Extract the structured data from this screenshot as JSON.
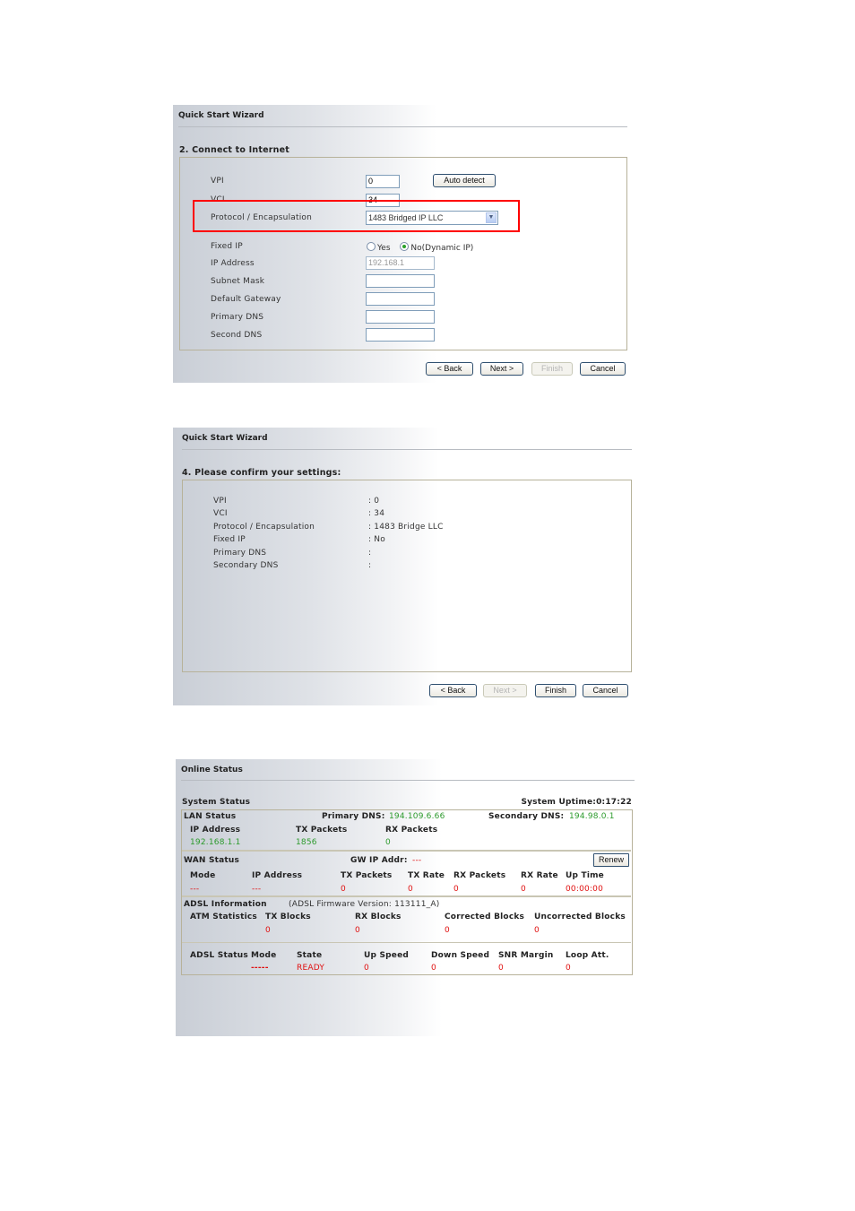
{
  "panel1": {
    "title": "Quick Start Wizard",
    "section_title": "2. Connect to Internet",
    "fields": {
      "vpi": {
        "label": "VPI",
        "value": "0"
      },
      "vci": {
        "label": "VCI",
        "value": "34"
      },
      "protocol": {
        "label": "Protocol / Encapsulation",
        "selected": "1483 Bridged IP LLC"
      },
      "fixed_ip": {
        "label": "Fixed IP",
        "options": [
          "Yes",
          "No(Dynamic IP)"
        ],
        "selected": "No(Dynamic IP)"
      },
      "ip_address": {
        "label": "IP Address",
        "value": "192.168.1"
      },
      "subnet_mask": {
        "label": "Subnet Mask",
        "value": ""
      },
      "default_gateway": {
        "label": "Default Gateway",
        "value": ""
      },
      "primary_dns": {
        "label": "Primary DNS",
        "value": ""
      },
      "second_dns": {
        "label": "Second DNS",
        "value": ""
      }
    },
    "auto_detect_label": "Auto detect",
    "buttons": {
      "back": "< Back",
      "next": "Next >",
      "finish": "Finish",
      "cancel": "Cancel"
    },
    "highlight_color": "#ff0000"
  },
  "panel2": {
    "title": "Quick Start Wizard",
    "section_title": "4. Please confirm your settings:",
    "rows": [
      {
        "label": "VPI",
        "value": ": 0"
      },
      {
        "label": "VCI",
        "value": ": 34"
      },
      {
        "label": "Protocol / Encapsulation",
        "value": ": 1483 Bridge LLC"
      },
      {
        "label": "Fixed IP",
        "value": ": No"
      },
      {
        "label": "Primary DNS",
        "value": ":"
      },
      {
        "label": "Secondary DNS",
        "value": ":"
      }
    ],
    "buttons": {
      "back": "< Back",
      "next": "Next >",
      "finish": "Finish",
      "cancel": "Cancel"
    }
  },
  "panel3": {
    "title": "Online Status",
    "system_status_label": "System Status",
    "system_uptime": "System Uptime:0:17:22",
    "lan": {
      "title": "LAN Status",
      "primary_dns_label": "Primary DNS:",
      "primary_dns": "194.109.6.66",
      "secondary_dns_label": "Secondary DNS:",
      "secondary_dns": "194.98.0.1",
      "headers": [
        "IP Address",
        "TX Packets",
        "RX Packets"
      ],
      "values": [
        "192.168.1.1",
        "1856",
        "0"
      ]
    },
    "wan": {
      "title": "WAN Status",
      "gw_label": "GW IP Addr:",
      "gw_value": "---",
      "renew_label": "Renew",
      "headers": [
        "Mode",
        "IP Address",
        "TX Packets",
        "TX Rate",
        "RX Packets",
        "RX Rate",
        "Up Time"
      ],
      "values": [
        "---",
        "---",
        "0",
        "0",
        "0",
        "0",
        "00:00:00"
      ]
    },
    "adsl": {
      "title": "ADSL Information",
      "firmware": "(ADSL Firmware Version:  113111_A)",
      "atm_headers": [
        "ATM Statistics",
        "TX Blocks",
        "RX Blocks",
        "Corrected Blocks",
        "Uncorrected Blocks"
      ],
      "atm_values": [
        "0",
        "0",
        "0",
        "0"
      ],
      "status_headers": [
        "ADSL Status",
        "Mode",
        "State",
        "Up Speed",
        "Down Speed",
        "SNR Margin",
        "Loop Att."
      ],
      "status_values": [
        "-----",
        "READY",
        "0",
        "0",
        "0",
        "0"
      ]
    },
    "colors": {
      "ok": "#2c9a2c",
      "error": "#e01010"
    }
  }
}
